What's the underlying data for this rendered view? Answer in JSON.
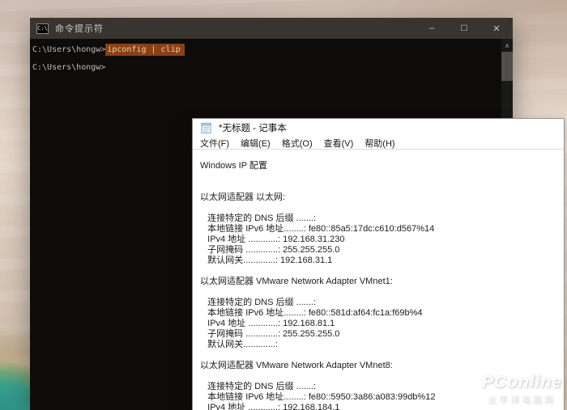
{
  "cmd_window": {
    "title": "命令提示符",
    "icon_text": "C:\\",
    "controls": {
      "minimize": "–",
      "maximize": "☐",
      "close": "✕"
    },
    "scrollbar_up_glyph": "∧",
    "lines": [
      {
        "prompt": "C:\\Users\\hongw>",
        "command": "ipconfig | clip",
        "selected": true
      },
      {
        "prompt": "C:\\Users\\hongw>",
        "command": "",
        "selected": false
      }
    ]
  },
  "notepad_window": {
    "title": "*无标题 - 记事本",
    "menu": [
      "文件(F)",
      "编辑(E)",
      "格式(O)",
      "查看(V)",
      "帮助(H)"
    ],
    "content_lines": [
      "Windows IP 配置",
      "",
      "",
      "以太网适配器 以太网:",
      "",
      "   连接特定的 DNS 后缀 .......:",
      "   本地链接 IPv6 地址........: fe80::85a5:17dc:c610:d567%14",
      "   IPv4 地址 ............: 192.168.31.230",
      "   子网掩码 .............: 255.255.255.0",
      "   默认网关.............: 192.168.31.1",
      "",
      "以太网适配器 VMware Network Adapter VMnet1:",
      "",
      "   连接特定的 DNS 后缀 .......:",
      "   本地链接 IPv6 地址........: fe80::581d:af64:fc1a:f69b%4",
      "   IPv4 地址 ............: 192.168.81.1",
      "   子网掩码 .............: 255.255.255.0",
      "   默认网关.............:",
      "",
      "以太网适配器 VMware Network Adapter VMnet8:",
      "",
      "   连接特定的 DNS 后缀 .......:",
      "   本地链接 IPv6 地址........: fe80::5950:3a86:a083:99db%12",
      "   IPv4 地址 ............: 192.168.184.1"
    ]
  },
  "watermark": {
    "brand": "PConline",
    "sub": "太平洋电脑网"
  },
  "colors": {
    "cmd_titlebar": "#3a3430",
    "cmd_background": "#0d0c0b",
    "cmd_selection": "#8d3f14",
    "desktop_sand": "#dacabe",
    "desktop_teal": "#39a08e"
  }
}
